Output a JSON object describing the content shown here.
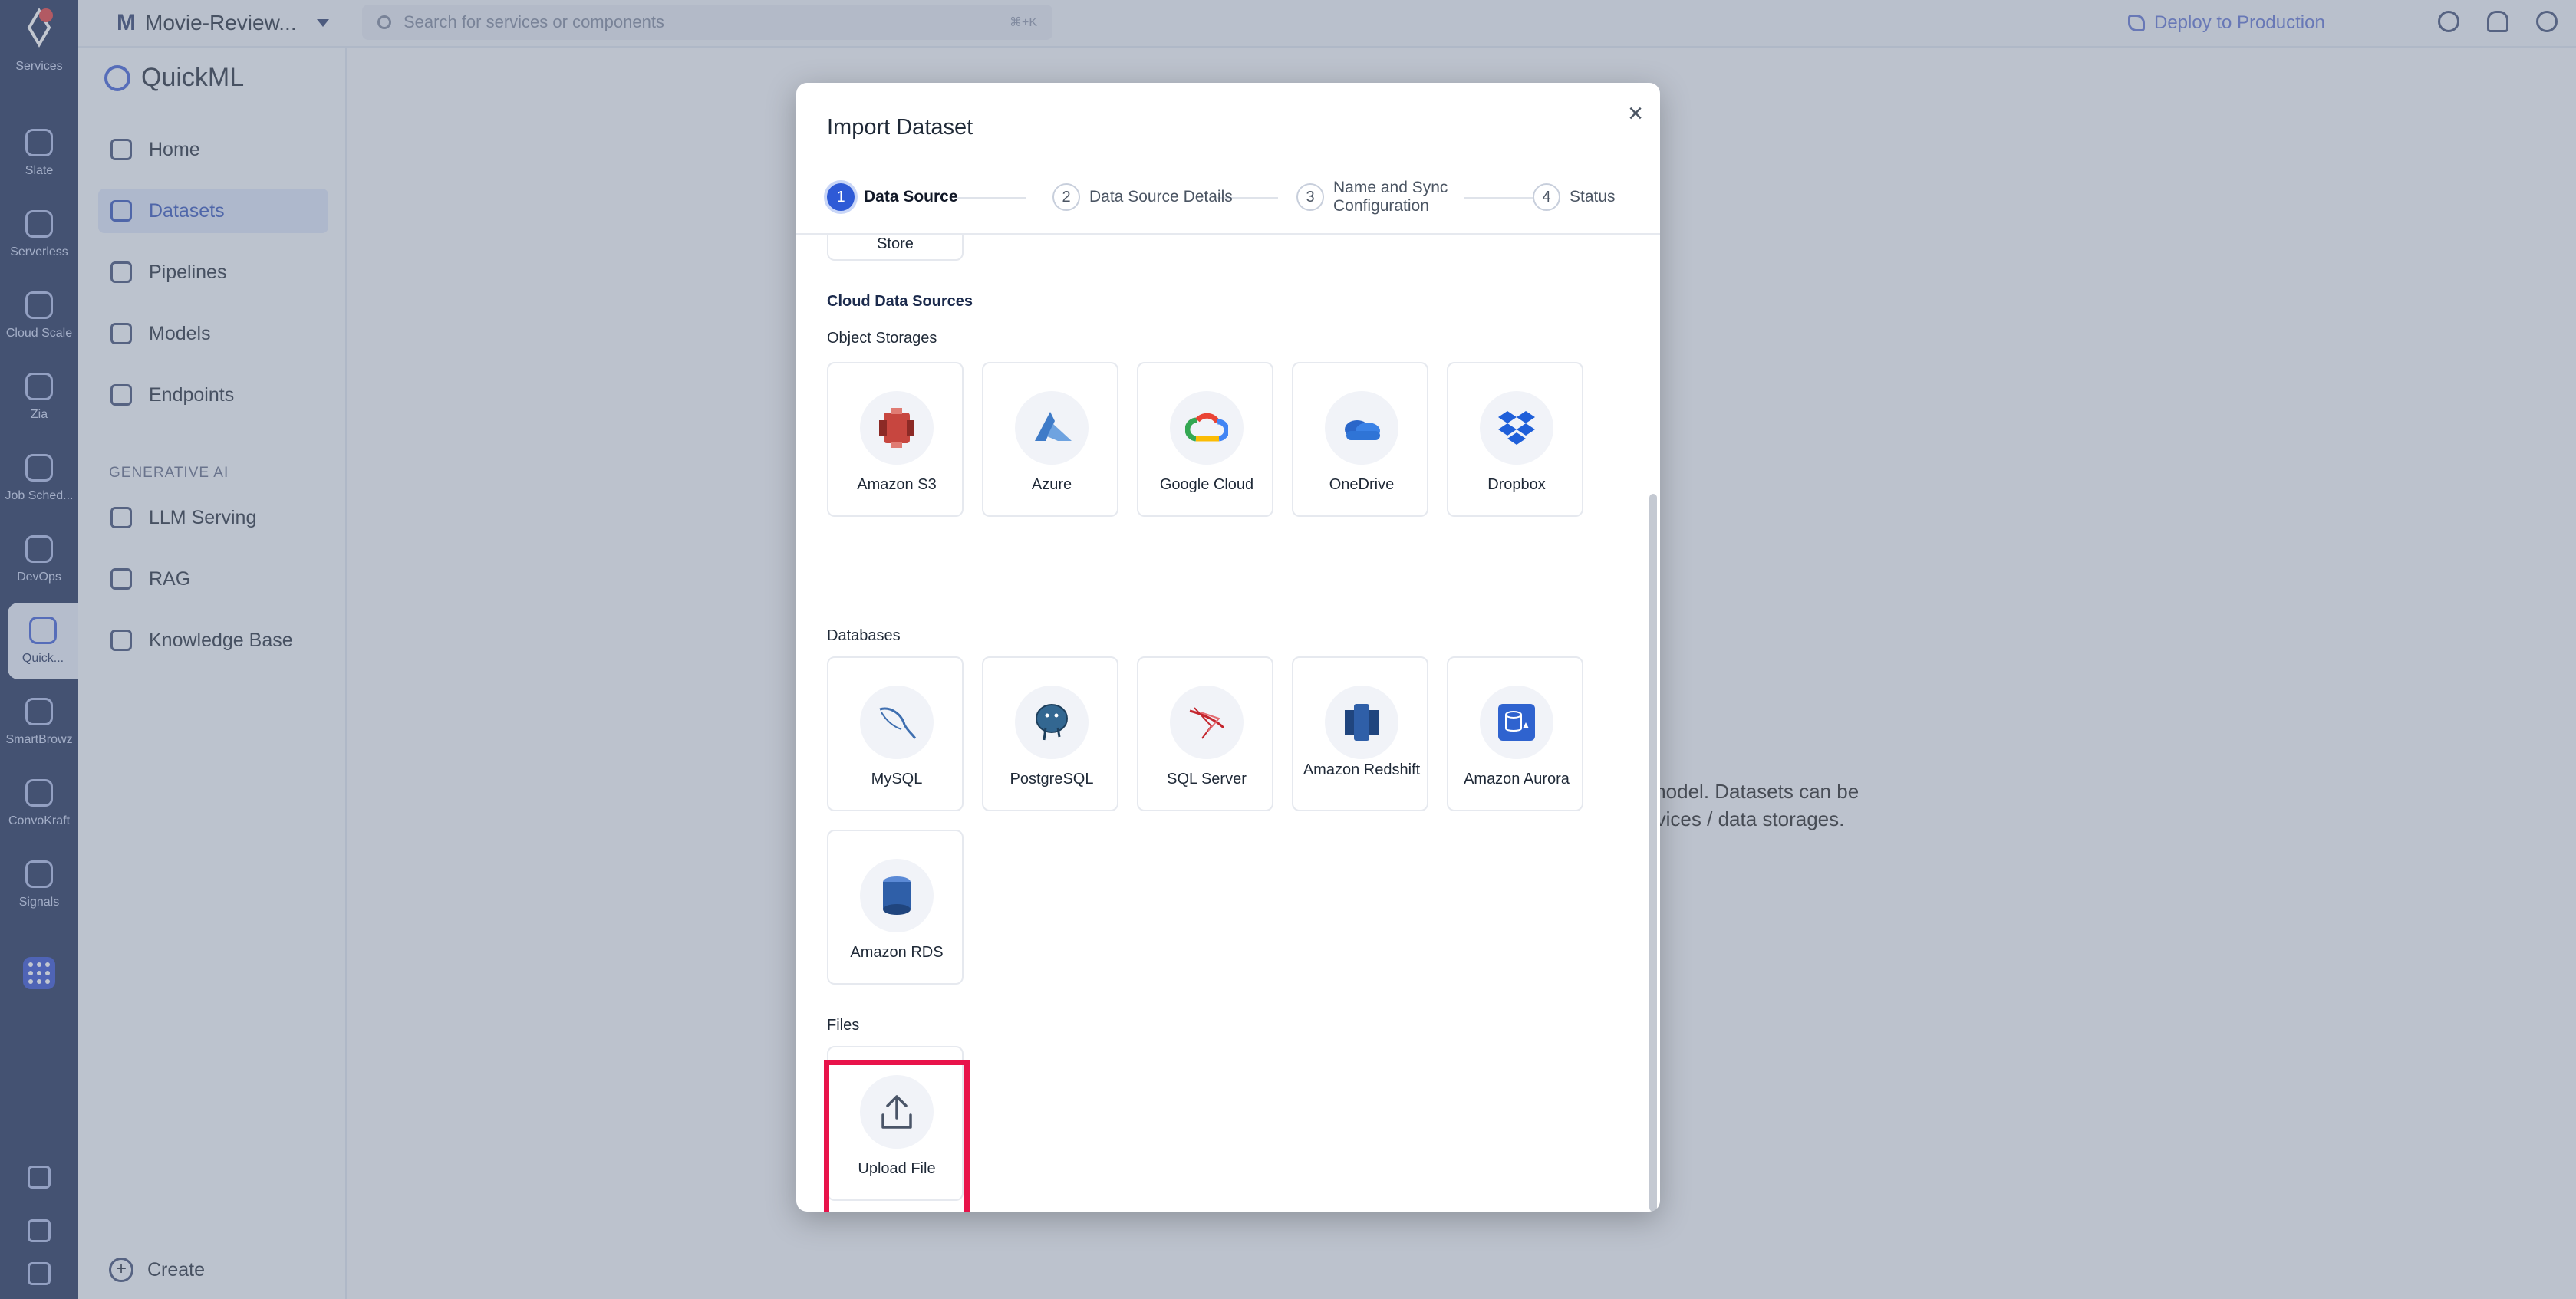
{
  "rail": {
    "items": [
      {
        "label": "Services",
        "icon": "services-icon"
      },
      {
        "label": "Slate",
        "icon": "slate-icon"
      },
      {
        "label": "Serverless",
        "icon": "serverless-icon"
      },
      {
        "label": "Cloud Scale",
        "icon": "cloud-scale-icon"
      },
      {
        "label": "Zia",
        "icon": "zia-icon"
      },
      {
        "label": "Job Sched...",
        "icon": "job-scheduler-icon"
      },
      {
        "label": "DevOps",
        "icon": "devops-icon"
      },
      {
        "label": "Quick...",
        "icon": "quickml-icon"
      },
      {
        "label": "SmartBrowz",
        "icon": "smartbrowz-icon"
      },
      {
        "label": "ConvoKraft",
        "icon": "convokraft-icon"
      },
      {
        "label": "Signals",
        "icon": "signals-icon"
      }
    ]
  },
  "topbar": {
    "project_initial": "M",
    "project_name": "Movie-Review...",
    "search_placeholder": "Search for services or components",
    "search_shortcut": "⌘+K",
    "deploy_label": "Deploy to Production"
  },
  "sidebar": {
    "brand": "QuickML",
    "items": [
      {
        "label": "Home"
      },
      {
        "label": "Datasets"
      },
      {
        "label": "Pipelines"
      },
      {
        "label": "Models"
      },
      {
        "label": "Endpoints"
      }
    ],
    "section_title": "GENERATIVE AI",
    "gen_items": [
      {
        "label": "LLM Serving"
      },
      {
        "label": "RAG"
      },
      {
        "label": "Knowledge Base"
      }
    ],
    "create_label": "Create"
  },
  "background": {
    "text_line1": "model. Datasets can be",
    "text_line2": "rvices / data storages."
  },
  "modal": {
    "title": "Import Dataset",
    "close": "×",
    "steps": [
      {
        "num": "1",
        "label": "Data Source"
      },
      {
        "num": "2",
        "label": "Data Source Details"
      },
      {
        "num": "3",
        "label": "Name and Sync Configuration"
      },
      {
        "num": "4",
        "label": "Status"
      }
    ],
    "partial_card_label": "Store",
    "cloud_section": "Cloud Data Sources",
    "object_storages_title": "Object Storages",
    "object_storages": [
      {
        "name": "Amazon S3"
      },
      {
        "name": "Azure"
      },
      {
        "name": "Google Cloud"
      },
      {
        "name": "OneDrive"
      },
      {
        "name": "Dropbox"
      }
    ],
    "databases_title": "Databases",
    "databases": [
      {
        "name": "MySQL"
      },
      {
        "name": "PostgreSQL"
      },
      {
        "name": "SQL Server"
      },
      {
        "name": "Amazon Redshift"
      },
      {
        "name": "Amazon Aurora"
      },
      {
        "name": "Amazon RDS"
      }
    ],
    "files_title": "Files",
    "files": [
      {
        "name": "Upload File"
      }
    ]
  },
  "colors": {
    "accent": "#2e5ad6",
    "rail": "#1b2a55",
    "highlight": "#e8134a"
  }
}
